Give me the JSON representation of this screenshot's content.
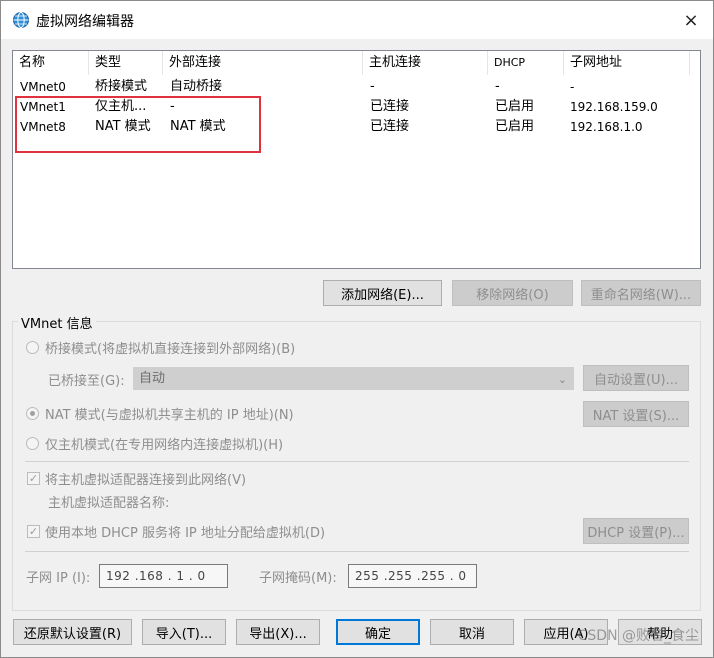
{
  "window": {
    "title": "虚拟网络编辑器",
    "close_icon": "×"
  },
  "network_table": {
    "columns": [
      "名称",
      "类型",
      "外部连接",
      "主机连接",
      "DHCP",
      "子网地址"
    ],
    "rows": [
      {
        "name": "VMnet0",
        "type": "桥接模式",
        "external": "自动桥接",
        "host": "-",
        "dhcp": "-",
        "subnet": "-"
      },
      {
        "name": "VMnet1",
        "type": "仅主机...",
        "external": "-",
        "host": "已连接",
        "dhcp": "已启用",
        "subnet": "192.168.159.0"
      },
      {
        "name": "VMnet8",
        "type": "NAT 模式",
        "external": "NAT 模式",
        "host": "已连接",
        "dhcp": "已启用",
        "subnet": "192.168.1.0"
      }
    ]
  },
  "list_buttons": {
    "add": "添加网络(E)...",
    "remove": "移除网络(O)",
    "rename": "重命名网络(W)..."
  },
  "vmnet_info": {
    "title": "VMnet 信息",
    "bridged_label": "桥接模式(将虚拟机直接连接到外部网络)(B)",
    "bridged_to_label": "已桥接至(G):",
    "bridged_to_value": "自动",
    "auto_settings": "自动设置(U)...",
    "nat_label": "NAT 模式(与虚拟机共享主机的 IP 地址)(N)",
    "nat_settings": "NAT 设置(S)...",
    "hostonly_label": "仅主机模式(在专用网络内连接虚拟机)(H)",
    "connect_adapter_label": "将主机虚拟适配器连接到此网络(V)",
    "adapter_name_label": "主机虚拟适配器名称:",
    "dhcp_label": "使用本地 DHCP 服务将 IP 地址分配给虚拟机(D)",
    "dhcp_settings": "DHCP 设置(P)...",
    "subnet_ip_label": "子网 IP (I):",
    "subnet_ip_value": "192 .168 . 1 . 0",
    "subnet_mask_label": "子网掩码(M):",
    "subnet_mask_value": "255 .255 .255 . 0"
  },
  "bottom_buttons": {
    "restore": "还原默认设置(R)",
    "import": "导入(T)...",
    "export": "导出(X)...",
    "ok": "确定",
    "cancel": "取消",
    "apply": "应用(A)",
    "help": "帮助"
  },
  "watermark": "CSDN @败者_食尘",
  "colors": {
    "highlight_box": "#e0323c",
    "default_button_border": "#0078d7"
  }
}
